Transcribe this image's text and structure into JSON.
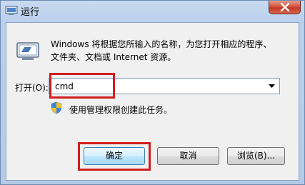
{
  "window": {
    "title": "运行",
    "close_symbol": "x"
  },
  "dialog": {
    "icon": "run-icon",
    "description_line1": "Windows 将根据您所输入的名称，为您打开相应的程序、",
    "description_line2": "文件夹、文档或 Internet 资源。",
    "open_label": "打开(O):",
    "command_value": "cmd",
    "admin_note": "使用管理权限创建此任务。"
  },
  "buttons": {
    "ok": "确定",
    "cancel": "取消",
    "browse": "浏览(B)..."
  },
  "colors": {
    "highlight": "#d11e1e",
    "title_gradient": "#b9d0ec",
    "close_button": "#c4392a"
  }
}
